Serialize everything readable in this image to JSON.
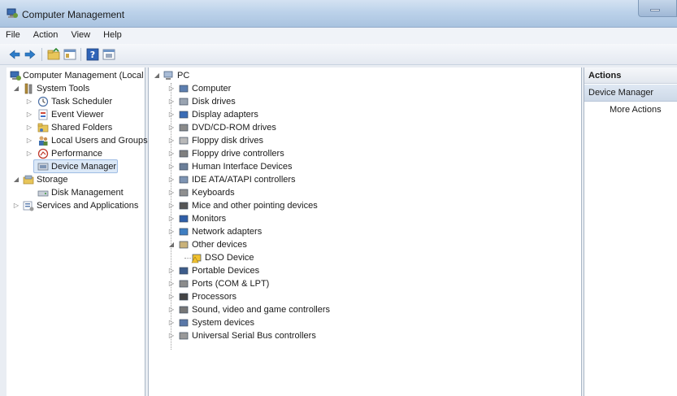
{
  "window": {
    "title": "Computer Management"
  },
  "menu": [
    "File",
    "Action",
    "View",
    "Help"
  ],
  "toolbar_icons": [
    "back-arrow-icon",
    "forward-arrow-icon",
    "up-folder-icon",
    "show-hide-tree-icon",
    "help-icon",
    "properties-icon"
  ],
  "left_tree": {
    "root": "Computer Management (Local",
    "system_tools": "System Tools",
    "task_scheduler": "Task Scheduler",
    "event_viewer": "Event Viewer",
    "shared_folders": "Shared Folders",
    "local_users": "Local Users and Groups",
    "performance": "Performance",
    "device_manager": "Device Manager",
    "storage": "Storage",
    "disk_management": "Disk Management",
    "services": "Services and Applications"
  },
  "device_tree": {
    "root": "PC",
    "items": [
      "Computer",
      "Disk drives",
      "Display adapters",
      "DVD/CD-ROM drives",
      "Floppy disk drives",
      "Floppy drive controllers",
      "Human Interface Devices",
      "IDE ATA/ATAPI controllers",
      "Keyboards",
      "Mice and other pointing devices",
      "Monitors",
      "Network adapters",
      "Other devices",
      "DSO Device",
      "Portable Devices",
      "Ports (COM & LPT)",
      "Processors",
      "Sound, video and game controllers",
      "System devices",
      "Universal Serial Bus controllers"
    ]
  },
  "actions": {
    "header": "Actions",
    "section": "Device Manager",
    "more": "More Actions"
  },
  "colors": {
    "titlebar": "#bcd2ea",
    "selection": "#dbe8f7",
    "warning": "#f2c230"
  }
}
